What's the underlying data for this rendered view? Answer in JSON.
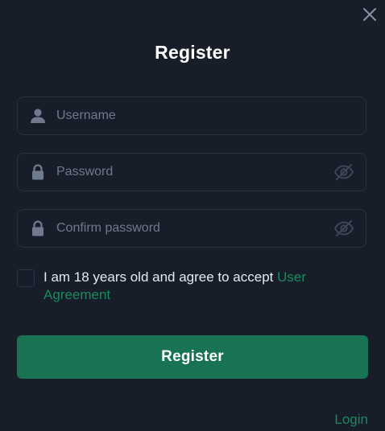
{
  "dialog": {
    "title": "Register",
    "close_icon": "close-icon"
  },
  "form": {
    "username": {
      "placeholder": "Username",
      "value": "",
      "icon": "user-icon"
    },
    "password": {
      "placeholder": "Password",
      "value": "",
      "icon": "lock-icon",
      "toggle_icon": "eye-off-icon"
    },
    "confirm_password": {
      "placeholder": "Confirm password",
      "value": "",
      "icon": "lock-icon",
      "toggle_icon": "eye-off-icon"
    },
    "agreement": {
      "text": "I am 18 years old and agree to accept ",
      "link_text": "User Agreement",
      "checked": false
    },
    "submit_label": "Register"
  },
  "footer": {
    "login_label": "Login"
  },
  "colors": {
    "background": "#171d29",
    "field_border": "#283142",
    "accent": "#187352",
    "link": "#1c8a5f",
    "icon": "#6f7a8c"
  }
}
